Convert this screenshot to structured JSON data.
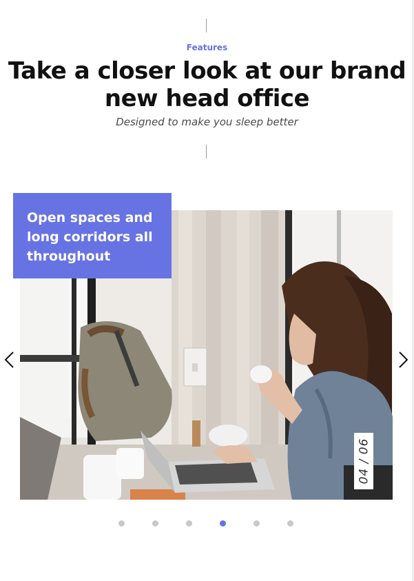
{
  "header": {
    "eyebrow": "Features",
    "title": "Take a closer look at our brand new head office",
    "subtitle": "Designed to make you sleep better"
  },
  "slider": {
    "caption": "Open spaces and long corridors all throughout",
    "counter": "04 / 06",
    "current_slide": 4,
    "total_slides": 6,
    "prev_icon": "chevron-left-icon",
    "next_icon": "chevron-right-icon"
  },
  "colors": {
    "accent": "#6773e3",
    "heading": "#111111",
    "dot_inactive": "#c8c8c8"
  }
}
